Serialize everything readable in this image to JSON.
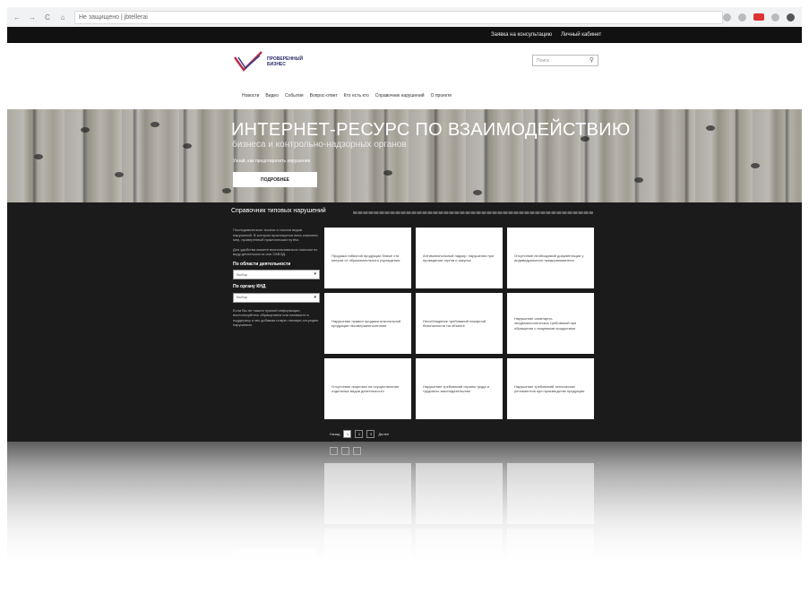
{
  "browser": {
    "address": "Не защищено | jbtellerai",
    "nav": [
      "←",
      "→",
      "C",
      "⌂"
    ]
  },
  "topbar": {
    "links": [
      "Заявка на консультацию",
      "Личный кабинет"
    ]
  },
  "header": {
    "logo_text": "ПРОВЕРЕННЫЙ БИЗНЕС",
    "search_placeholder": "Поиск",
    "search_icon": "search-icon"
  },
  "menu": {
    "items": [
      "Новости",
      "Видео",
      "События",
      "Вопрос-ответ",
      "Кто есть кто",
      "Справочник нарушений",
      "О проекте"
    ]
  },
  "hero": {
    "title": "ИНТЕРНЕТ-РЕСУРС ПО ВЗАИМОДЕЙСТВИЮ",
    "subtitle": "бизнеса и контрольно-надзорных органов",
    "hint": "Узнай, как предотвратить нарушения",
    "button": "ПОДРОБНЕЕ"
  },
  "section": {
    "title": "Справочник типовых нарушений"
  },
  "sidebar": {
    "intro": "Последовательно тысячи и тысячи видов нарушений. В котором практикуется весь комплекс мер, проверенный практическим путём.",
    "intro2": "Для удобства можете воспользоваться поиском по виду деятельности или ОКВЭД.",
    "filter1_label": "По области деятельности",
    "filter1_value": "Выбор",
    "filter2_label": "По органу КНД",
    "filter2_value": "Выбор",
    "note": "Если Вы не нашли нужной информации, воспользуйтесь обращением или напишите в поддержку и мы добавим новую типовую ситуацию нарушения."
  },
  "cards": [
    "Продажа табачной продукции ближе ста метров от образовательного учреждения",
    "Антимонопольный надзор: нарушения при проведении торгов и закупок",
    "Отсутствие необходимой документации у индивидуального предпринимателя",
    "Нарушение правил продажи алкогольной продукции несовершеннолетним",
    "Несоблюдение требований пожарной безопасности на объекте",
    "Нарушение санитарно-эпидемиологических требований при обращении с пищевыми продуктами",
    "Отсутствие лицензии на осуществление отдельных видов деятельности",
    "Нарушение требований охраны труда и трудового законодательства",
    "Нарушение требований технических регламентов при производстве продукции"
  ],
  "pager": {
    "prev": "Назад",
    "pages": [
      "1",
      "2",
      "3"
    ],
    "next": "Далее"
  }
}
